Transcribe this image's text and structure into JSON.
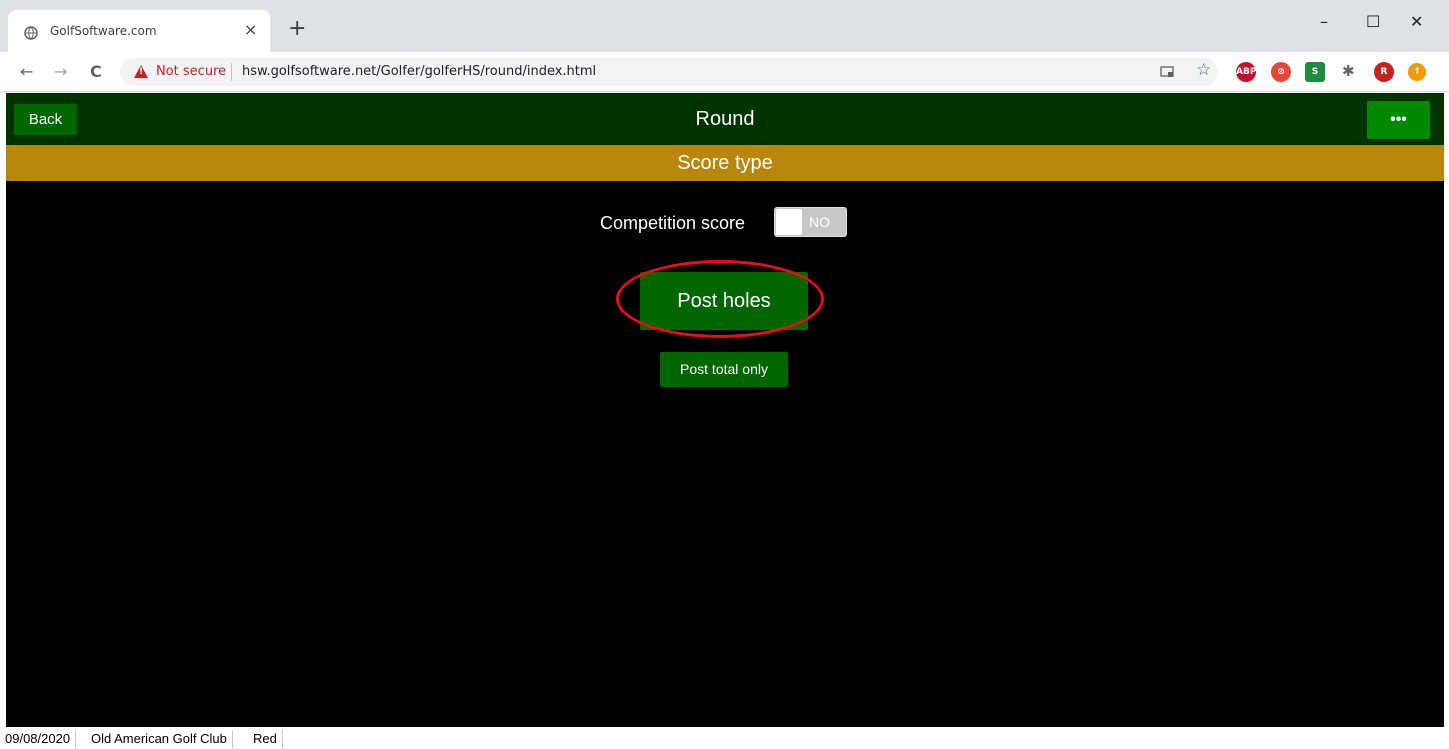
{
  "browser": {
    "tab_title": "GolfSoftware.com",
    "tab_close": "×",
    "new_tab": "+",
    "minimize": "–",
    "maximize": "☐",
    "close": "✕",
    "back": "←",
    "forward": "→",
    "reload": "C",
    "security_label": "Not secure",
    "url": "hsw.golfsoftware.net/Golfer/golferHS/round/index.html",
    "extensions": [
      {
        "name": "adblock-plus",
        "text": "ABP",
        "color": "#c70d2c"
      },
      {
        "name": "extension-red",
        "text": "⊘",
        "color": "#e5453b"
      },
      {
        "name": "extension-green",
        "text": "S",
        "color": "#1e8e3e"
      },
      {
        "name": "profile",
        "text": "R",
        "color": "#c5221f"
      },
      {
        "name": "extension-orange",
        "text": "↑",
        "color": "#f29900"
      }
    ]
  },
  "app": {
    "back_label": "Back",
    "title": "Round",
    "more_label": "•••",
    "subtitle": "Score type",
    "competition_label": "Competition score",
    "toggle_value": "NO",
    "post_holes_label": "Post holes",
    "post_total_label": "Post total only",
    "colors": {
      "header": "#003300",
      "subheader": "#b8860b",
      "button": "#006600",
      "highlight": "#e3101a"
    }
  },
  "status": {
    "date": "09/08/2020",
    "club": "Old American Golf Club",
    "tee": "Red"
  }
}
